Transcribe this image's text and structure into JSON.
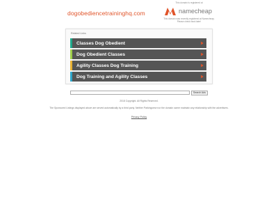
{
  "domain": "dogobediencetraininghq.com",
  "registrar": {
    "top_note": "This domain is registered at",
    "logo_text": "namecheap",
    "note": "This domain was recently registered at Namecheap. Please check back later!",
    "brand_color": "#e0542a"
  },
  "related": {
    "header": "Related Links",
    "links": [
      {
        "label": "Classes Dog Obedient",
        "accent": "#1fa98b"
      },
      {
        "label": "Dog Obedient Classes",
        "accent": "#9fcf49"
      },
      {
        "label": "Agility Classes Dog Training",
        "accent": "#e9b233"
      },
      {
        "label": "Dog Training and Agility Classes",
        "accent": "#2fa6c9"
      }
    ],
    "arrow_color": "#e0542a"
  },
  "search": {
    "value": "",
    "button_label": "Search Ads"
  },
  "footer": {
    "copyright": "2018 Copyright. All Rights Reserved.",
    "disclaimer": "The Sponsored Listings displayed above are served automatically by a third party. Neither Parkingcrew nor the domain owner maintain any relationship with the advertisers.",
    "privacy": "Privacy Policy"
  }
}
